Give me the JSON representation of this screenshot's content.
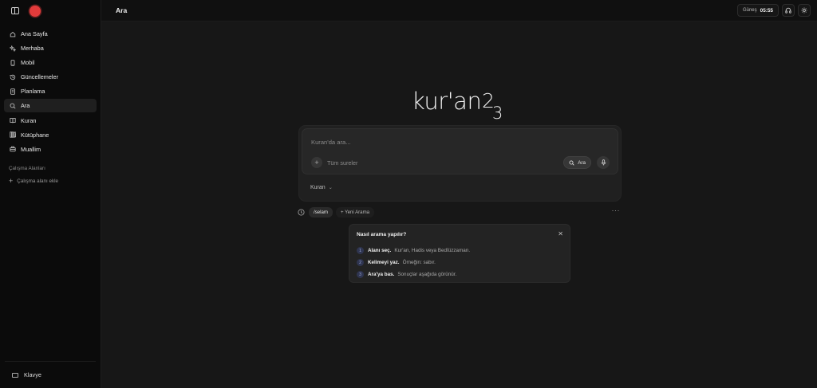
{
  "sidebar": {
    "items": [
      {
        "label": "Ana Sayfa",
        "icon": "home-icon"
      },
      {
        "label": "Merhaba",
        "icon": "sparkle-icon"
      },
      {
        "label": "Mobil",
        "icon": "phone-icon"
      },
      {
        "label": "Güncellemeler",
        "icon": "history-icon"
      },
      {
        "label": "Planlama",
        "icon": "document-icon"
      },
      {
        "label": "Ara",
        "icon": "search-icon",
        "active": true
      },
      {
        "label": "Kuran",
        "icon": "book-icon"
      },
      {
        "label": "Kütüphane",
        "icon": "library-icon"
      },
      {
        "label": "Muallim",
        "icon": "teacher-icon"
      }
    ],
    "workspaces_title": "Çalışma Alanları",
    "add_workspace": "Çalışma alanı ekle",
    "keyboard_label": "Klavye"
  },
  "header": {
    "title": "Ara",
    "sun_label": "Güneş",
    "sun_time": "05:55"
  },
  "brand": {
    "name": "kur'an",
    "number_top": "2",
    "number_bottom": "3"
  },
  "search": {
    "placeholder": "Kuran'da ara...",
    "scope": "Tüm sureler",
    "button_label": "Ara",
    "source": "Kuran"
  },
  "history": {
    "tag": "/selam",
    "new_search": "+ Yeni Arama"
  },
  "help": {
    "title": "Nasıl arama yapılır?",
    "steps": [
      {
        "num": "1",
        "bold": "Alanı seç.",
        "text": "Kur'an, Hadis veya Bedîüzzaman."
      },
      {
        "num": "2",
        "bold": "Kelimeyi yaz.",
        "text": "Örneğin: sabır."
      },
      {
        "num": "3",
        "bold": "Ara'ya bas.",
        "text": "Sonuçlar aşağıda görünür."
      }
    ]
  },
  "colors": {
    "accent_logo": "#e23b3b",
    "background": "#171717",
    "sidebar": "#0b0b0b"
  }
}
